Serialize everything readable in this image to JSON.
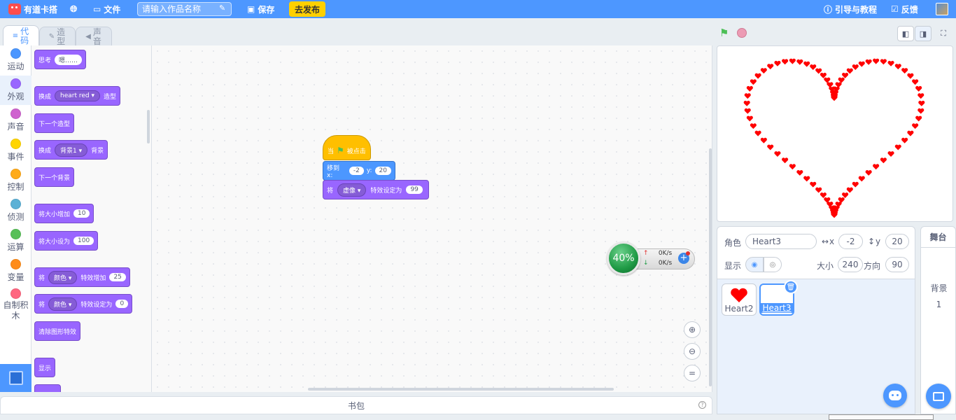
{
  "menubar": {
    "brand": "有道卡搭",
    "file": "文件",
    "title_placeholder": "请输入作品名称",
    "save": "保存",
    "publish": "去发布",
    "tutorial": "引导与教程",
    "feedback": "反馈"
  },
  "tabs": {
    "code": "代码",
    "costumes": "造型",
    "sounds": "声音"
  },
  "categories": [
    {
      "label": "运动",
      "color": "#4c97ff"
    },
    {
      "label": "外观",
      "color": "#9966ff"
    },
    {
      "label": "声音",
      "color": "#cf63cf"
    },
    {
      "label": "事件",
      "color": "#ffd500"
    },
    {
      "label": "控制",
      "color": "#ffab19"
    },
    {
      "label": "侦测",
      "color": "#5cb1d6"
    },
    {
      "label": "运算",
      "color": "#59c059"
    },
    {
      "label": "变量",
      "color": "#ff8c1a"
    },
    {
      "label": "自制积木",
      "color": "#ff6680"
    }
  ],
  "palette": {
    "think": "思考",
    "think_val": "嗯……",
    "switch_costume": "换成",
    "costume_val": "heart red",
    "costume_suffix": "造型",
    "next_costume": "下一个造型",
    "switch_backdrop": "换成",
    "backdrop_val": "背景1",
    "backdrop_suffix": "背景",
    "next_backdrop": "下一个背景",
    "change_size": "将大小增加",
    "change_size_val": "10",
    "set_size": "将大小设为",
    "set_size_val": "100",
    "change_effect": "将",
    "change_effect_drop": "颜色",
    "change_effect_mid": "特效增加",
    "change_effect_val": "25",
    "set_effect": "将",
    "set_effect_drop": "颜色",
    "set_effect_mid": "特效设定为",
    "set_effect_val": "0",
    "clear_effects": "清除图形特效",
    "show": "显示"
  },
  "script": {
    "hat_when": "当",
    "hat_clicked": "被点击",
    "goto": "移到 x:",
    "goto_x": "-2",
    "goto_y_label": "y:",
    "goto_y": "20",
    "set_prefix": "将",
    "set_drop": "虚像",
    "set_mid": "特效设定为",
    "set_val": "99"
  },
  "network": {
    "percent": "40%",
    "up": "0K/s",
    "down": "0K/s"
  },
  "backpack": "书包",
  "sprite_info": {
    "sprite_label": "角色",
    "sprite_name": "Heart3",
    "x_label": "x",
    "x": "-2",
    "y_label": "y",
    "y": "20",
    "show_label": "显示",
    "size_label": "大小",
    "size": "240",
    "dir_label": "方向",
    "direction": "90"
  },
  "sprites": [
    {
      "name": "Heart2"
    },
    {
      "name": "Heart3"
    }
  ],
  "stage_panel": {
    "title": "舞台",
    "backdrop_label": "背景",
    "backdrop_count": "1"
  },
  "colors": {
    "accent": "#4d97ff",
    "looks": "#9966ff",
    "motion": "#4c97ff",
    "events": "#ffbf00",
    "heart": "#ff0000"
  }
}
